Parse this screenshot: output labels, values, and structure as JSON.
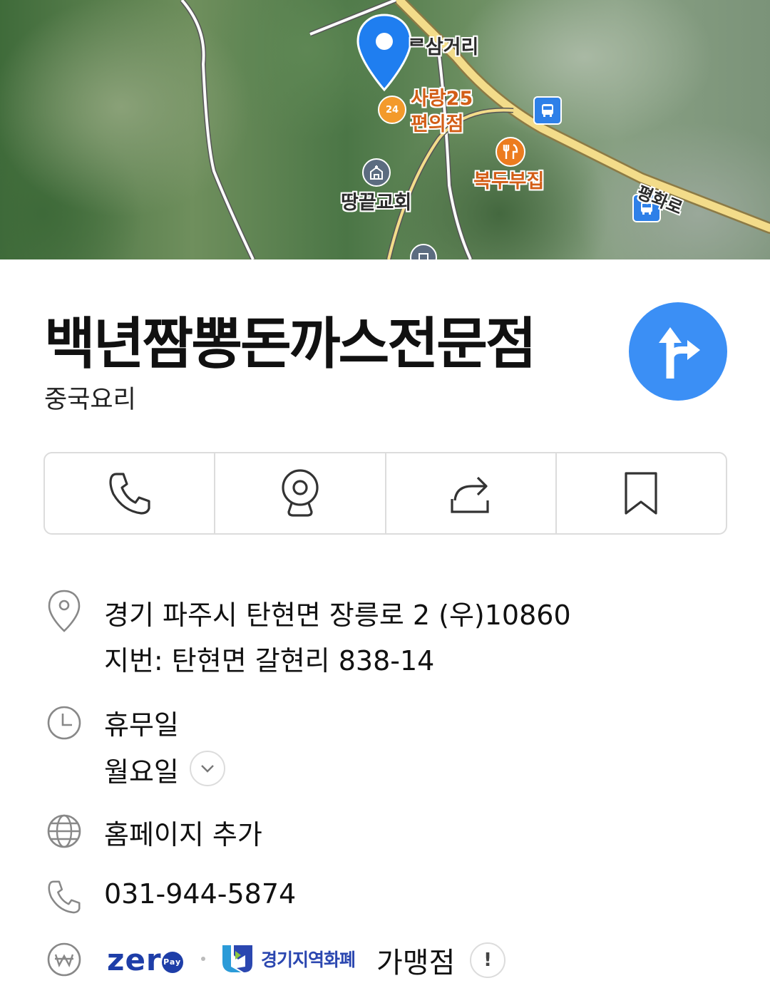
{
  "map": {
    "labels": {
      "intersection": "ᄅ삼거리",
      "store_line1": "사랑25",
      "store_line2": "편의점",
      "restaurant": "복두부집",
      "church": "땅끝교회",
      "road": "평화로"
    },
    "poi_store_badge": "24",
    "icons": {
      "pin": "location-pin-icon",
      "store": "convenience-store-icon",
      "restaurant": "restaurant-icon",
      "church": "church-icon",
      "bus": "bus-stop-icon",
      "building": "building-icon"
    }
  },
  "place": {
    "name": "백년짬뽕돈까스전문점",
    "category": "중국요리"
  },
  "actions": [
    {
      "name": "call",
      "icon": "phone-icon"
    },
    {
      "name": "roadview",
      "icon": "camera-icon"
    },
    {
      "name": "share",
      "icon": "share-icon"
    },
    {
      "name": "save",
      "icon": "bookmark-icon"
    }
  ],
  "info": {
    "address": "경기 파주시 탄현면 장릉로 2 (우)10860",
    "lot_address": "지번: 탄현면 갈현리 838-14",
    "hours_label": "휴무일",
    "hours_value": "월요일",
    "homepage": "홈페이지 추가",
    "phone": "031-944-5874",
    "payment": {
      "zero_pay": "zer",
      "zero_pay_mark": "Pay",
      "gg_currency": "경기지역화폐",
      "affiliate": "가맹점",
      "info_mark": "!"
    }
  },
  "colors": {
    "accent": "#3b8ff5",
    "marker": "#1f7ef0",
    "road": "#f3dc8a",
    "border": "#dcdcdc"
  }
}
